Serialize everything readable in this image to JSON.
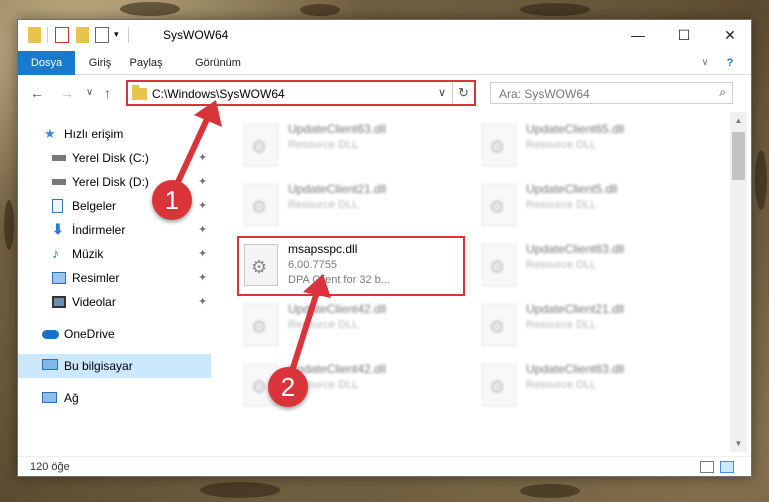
{
  "window": {
    "title": "SysWOW64",
    "controls": {
      "minimize": "—",
      "maximize": "☐",
      "close": "✕"
    }
  },
  "ribbon": {
    "tabs": [
      "Dosya",
      "Giriş",
      "Paylaş",
      "Görünüm"
    ],
    "help_glyph": "?"
  },
  "address_bar": {
    "path": "C:\\Windows\\SysWOW64",
    "dropdown_glyph": "∨",
    "refresh_glyph": "↻"
  },
  "search": {
    "placeholder": "Ara: SysWOW64",
    "icon_glyph": "⌕"
  },
  "nav": {
    "back": "←",
    "forward": "→",
    "recent": "∨",
    "up": "↑"
  },
  "sidebar": {
    "items": [
      {
        "label": "Hızlı erişim",
        "icon": "star-icon"
      },
      {
        "label": "Yerel Disk (C:)",
        "icon": "drive-icon",
        "pinned": true
      },
      {
        "label": "Yerel Disk (D:)",
        "icon": "drive-icon",
        "pinned": true
      },
      {
        "label": "Belgeler",
        "icon": "document-icon",
        "pinned": true
      },
      {
        "label": "İndirmeler",
        "icon": "download-icon",
        "pinned": true
      },
      {
        "label": "Müzik",
        "icon": "music-icon",
        "pinned": true
      },
      {
        "label": "Resimler",
        "icon": "picture-icon",
        "pinned": true
      },
      {
        "label": "Videolar",
        "icon": "video-icon",
        "pinned": true
      },
      {
        "label": "OneDrive",
        "icon": "cloud-icon"
      },
      {
        "label": "Bu bilgisayar",
        "icon": "computer-icon",
        "selected": true
      },
      {
        "label": "Ağ",
        "icon": "network-icon"
      }
    ],
    "pin_glyph": "📌"
  },
  "files": {
    "blurred": [
      {
        "name": "UpdateClient63.dll",
        "type": "Resource DLL"
      },
      {
        "name": "UpdateClient65.dll",
        "type": "Resource DLL"
      },
      {
        "name": "UpdateClient21.dll",
        "type": "Resource DLL"
      },
      {
        "name": "UpdateClient5.dll",
        "type": "Resource DLL"
      },
      {
        "name": "UpdateClient63.dll",
        "type": "Resource DLL"
      },
      {
        "name": "UpdateClient42.dll",
        "type": "Resource DLL"
      },
      {
        "name": "UpdateClient21.dll",
        "type": "Resource DLL"
      },
      {
        "name": "UpdateClient42.dll",
        "type": "Resource DLL"
      },
      {
        "name": "UpdateClient63.dll",
        "type": "Resource DLL"
      }
    ],
    "highlighted": {
      "name": "msapsspc.dll",
      "version": "6.00.7755",
      "description": "DPA Client for 32 b..."
    }
  },
  "status": {
    "item_count": "120 öğe"
  },
  "annotations": {
    "step1": "1",
    "step2": "2",
    "color": "#d9343a"
  }
}
